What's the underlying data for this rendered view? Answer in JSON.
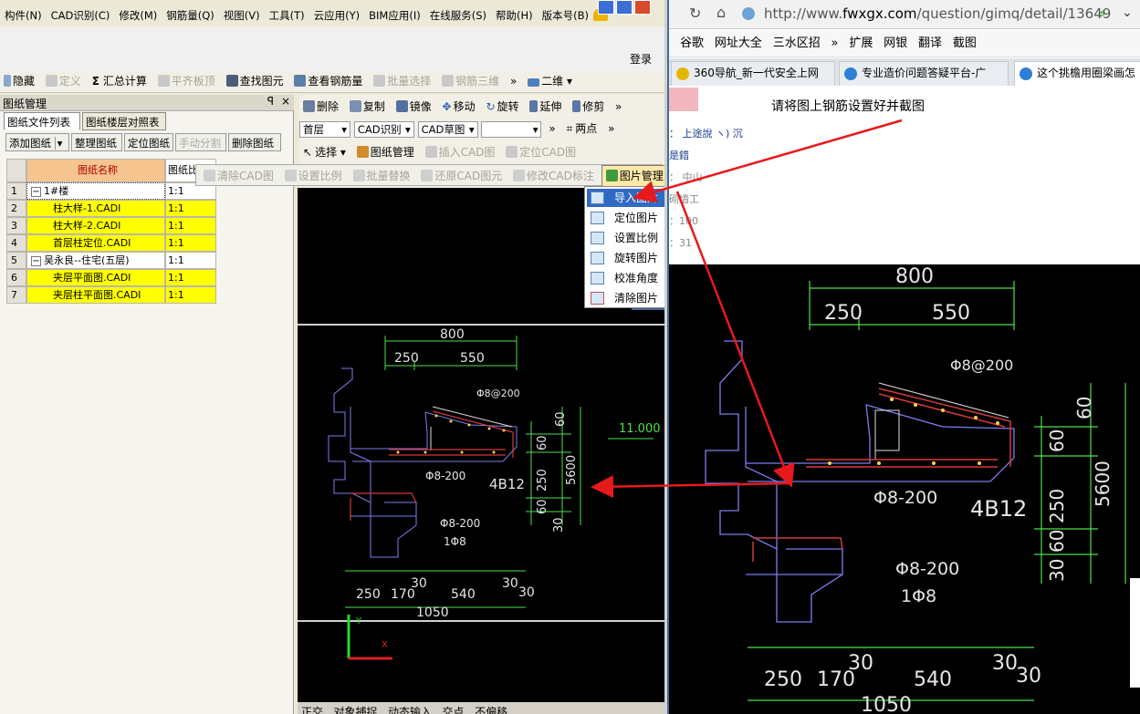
{
  "menu": [
    "构件(N)",
    "CAD识别(C)",
    "修改(M)",
    "钢筋量(Q)",
    "视图(V)",
    "工具(T)",
    "云应用(Y)",
    "BIM应用(I)",
    "在线服务(S)",
    "帮助(H)",
    "版本号(B)"
  ],
  "login": "登录",
  "main_toolbar": {
    "hide": "隐藏",
    "define": "定义",
    "sum_calc": "汇总计算",
    "flat_board": "平齐板顶",
    "find_element": "查找图元",
    "view_rebar": "查看钢筋量",
    "batch_select": "批量选择",
    "rebar_3d": "钢筋三维",
    "more": "»",
    "view_mode": "二维"
  },
  "left_panel": {
    "title": "图纸管理",
    "pin": "ꟼ",
    "close": "×",
    "tabs": [
      "图纸文件列表",
      "图纸楼层对照表"
    ],
    "actions": [
      "添加图纸",
      "整理图纸",
      "定位图纸",
      "手动分割",
      "删除图纸"
    ],
    "columns": [
      "图纸名称",
      "图纸比"
    ],
    "rows": [
      {
        "num": "1",
        "name": "1#楼",
        "scale": "1:1",
        "expander": "−"
      },
      {
        "num": "2",
        "name": "柱大样-1.CADI",
        "scale": "1:1"
      },
      {
        "num": "3",
        "name": "柱大样-2.CADI",
        "scale": "1:1"
      },
      {
        "num": "4",
        "name": "首层柱定位.CADI",
        "scale": "1:1"
      },
      {
        "num": "5",
        "name": "吴永良--住宅(五层)",
        "scale": "1:1",
        "expander": "−"
      },
      {
        "num": "6",
        "name": "夹层平面图.CADI",
        "scale": "1:1"
      },
      {
        "num": "7",
        "name": "夹层柱平面图.CADI",
        "scale": "1:1"
      }
    ]
  },
  "edit_toolbar": {
    "delete": "删除",
    "copy": "复制",
    "mirror": "镜像",
    "move": "移动",
    "rotate": "旋转",
    "extend": "延伸",
    "trim": "修剪",
    "floor": "首层",
    "cad_recog": "CAD识别",
    "cad_draft": "CAD草图",
    "two_points": "两点",
    "select": "选择",
    "drawing_mgmt": "图纸管理",
    "insert_cad": "插入CAD图",
    "locate_cad": "定位CAD图"
  },
  "cad_toolbar": {
    "clear_cad": "清除CAD图",
    "set_scale": "设置比例",
    "batch_replace": "批量替换",
    "restore_cad": "还原CAD图元",
    "modify_cad_label": "修改CAD标注",
    "picture_mgmt": "图片管理"
  },
  "picture_menu": [
    "导入图片",
    "定位图片",
    "设置比例",
    "旋转图片",
    "校准角度",
    "清除图片"
  ],
  "cad_status": [
    "正交",
    "对象捕捉",
    "动态输入",
    "交点",
    "不偏移"
  ],
  "cad_drawing": {
    "dim_top": "800",
    "dim_250": "250",
    "dim_550": "550",
    "rebar_top": "Φ8@200",
    "elev": "11.000",
    "dim_60a": "60",
    "dim_60b": "60",
    "dim_250v": "250",
    "dim_60c": "60",
    "dim_30": "30",
    "dim_560": "5600",
    "rebar_mid": "Φ8-200",
    "rebar_4b12": "4B12",
    "rebar_low": "Φ8-200",
    "rebar_low2": "1Φ8",
    "dim_b250": "250",
    "dim_b170": "170",
    "dim_b30a": "30",
    "dim_b540": "540",
    "dim_b30b": "30",
    "dim_b30c": "30",
    "dim_b1050": "1050"
  },
  "browser": {
    "url_prefix": "http://www.",
    "url_domain": "fwxgx.com",
    "url_path": "/question/gimq/detail/13649",
    "bookmarks": [
      "谷歌",
      "网址大全",
      "三水区招",
      "»",
      "扩展",
      "网银",
      "翻译",
      "截图"
    ],
    "tabs": [
      "360导航_新一代安全上网",
      "专业造价问题答疑平台-广",
      "这个挑檐用圈梁画怎"
    ],
    "question_title": "请将图上钢筋设置好并截图",
    "side_texts": [
      "： 上途說 ヽ) 沉",
      "是錯",
      "： 中山",
      "砌墙工",
      "：100",
      "：31"
    ]
  },
  "colors": {
    "arrow": "#e8191d",
    "cad_bg": "#000000",
    "yellow_row": "#ffff00",
    "header_row": "#f6c48f"
  }
}
